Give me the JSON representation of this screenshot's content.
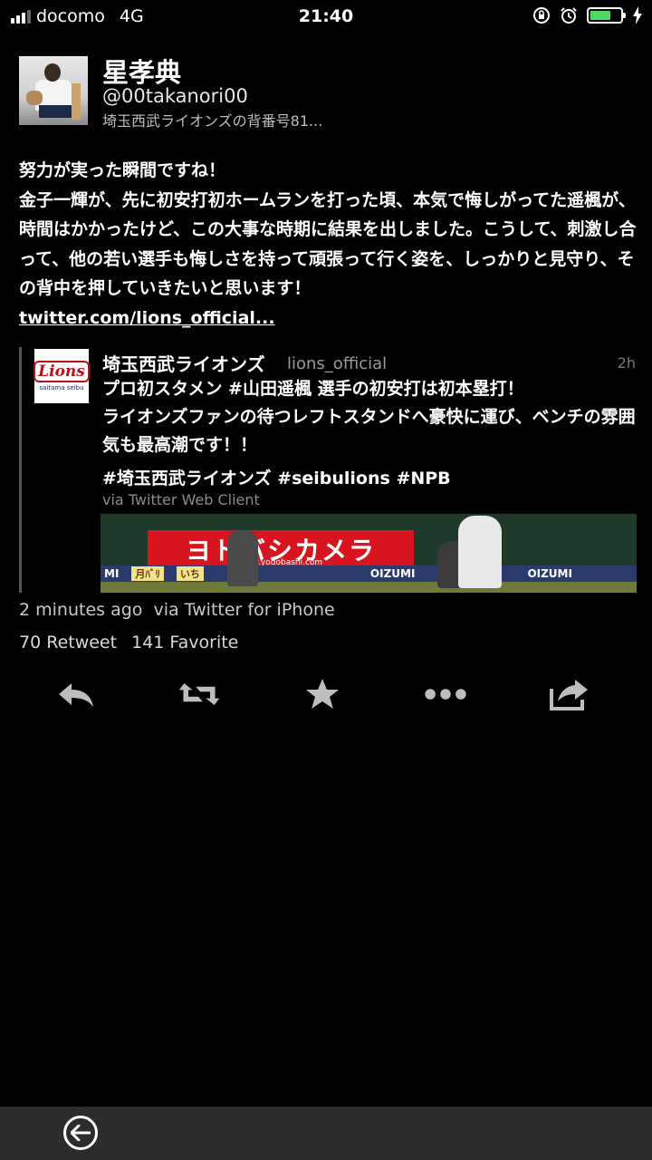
{
  "status_bar": {
    "carrier": "docomo",
    "network": "4G",
    "time": "21:40",
    "battery_percent": 70,
    "icons": [
      "orientation-lock-icon",
      "alarm-icon",
      "battery-icon",
      "charging-icon"
    ]
  },
  "tweet": {
    "author": {
      "name": "星孝典",
      "handle": "@00takanori00",
      "bio": "埼玉西武ライオンズの背番号81..."
    },
    "text": {
      "line1": "努力が実った瞬間ですね！",
      "line2": "金子一輝が、先に初安打初ホームランを打った頃、本気で悔しがってた遥楓が、時間はかかったけど、この大事な時期に結果を出しました。こうして、刺激し合って、他の若い選手も悔しさを持って頑張って行く姿を、しっかりと見守り、その背中を押していきたいと思います！",
      "link": "twitter.com/lions_official..."
    },
    "quoted": {
      "name": "埼玉西武ライオンズ",
      "handle": "lions_official",
      "time": "2h",
      "avatar_text": "Lions",
      "avatar_subtext": "saitama seibu",
      "line1": "プロ初スタメン #山田遥楓 選手の初安打は初本塁打！",
      "line2": "ライオンズファンの待つレフトスタンドへ豪快に運び、ベンチの雰囲気も最高潮です！！",
      "tags": "#埼玉西武ライオンズ #seibulions #NPB",
      "via": "via Twitter Web Client",
      "media": {
        "sign_text": "ヨドバシカメラ",
        "sign_url": "www.yodobashi.com",
        "band": [
          "MI",
          "OIZUMI",
          "OIZUMI"
        ]
      }
    },
    "meta": {
      "time": "2 minutes ago",
      "source": "via Twitter for iPhone"
    },
    "counts": {
      "retweets": "70 Retweet",
      "favorites": "141 Favorite"
    }
  },
  "actions": [
    "reply-icon",
    "retweet-icon",
    "favorite-icon",
    "more-icon",
    "share-icon"
  ],
  "colors": {
    "background": "#000000",
    "battery": "#4cd964",
    "bottom_bar": "#2c2c2c"
  }
}
